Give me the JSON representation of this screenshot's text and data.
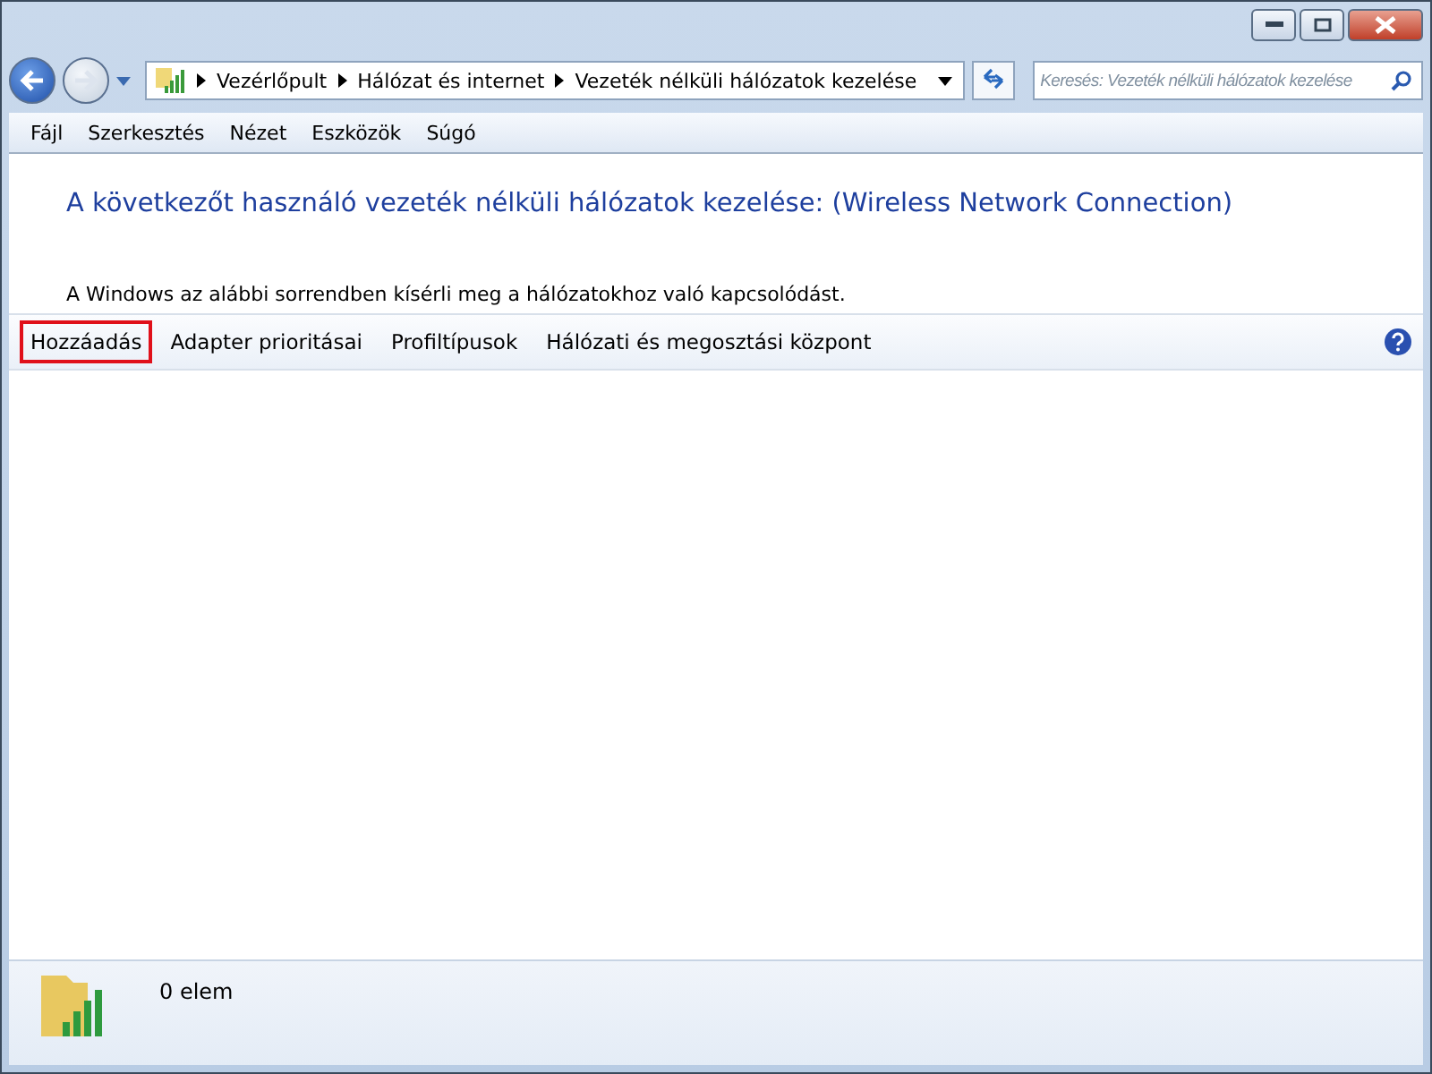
{
  "address_bar": {
    "crumbs": [
      "Vezérlőpult",
      "Hálózat és internet",
      "Vezeték nélküli hálózatok kezelése"
    ]
  },
  "search": {
    "placeholder": "Keresés: Vezeték nélküli hálózatok kezelése"
  },
  "menu": [
    "Fájl",
    "Szerkesztés",
    "Nézet",
    "Eszközök",
    "Súgó"
  ],
  "header": {
    "title": "A következőt használó vezeték nélküli hálózatok kezelése: (Wireless Network Connection)",
    "description": "A Windows az alábbi sorrendben kísérli meg a hálózatokhoz való kapcsolódást."
  },
  "commands": [
    {
      "label": "Hozzáadás",
      "highlighted": true
    },
    {
      "label": "Adapter prioritásai",
      "highlighted": false
    },
    {
      "label": "Profiltípusok",
      "highlighted": false
    },
    {
      "label": "Hálózati és megosztási központ",
      "highlighted": false
    }
  ],
  "status": {
    "count": "0 elem"
  }
}
